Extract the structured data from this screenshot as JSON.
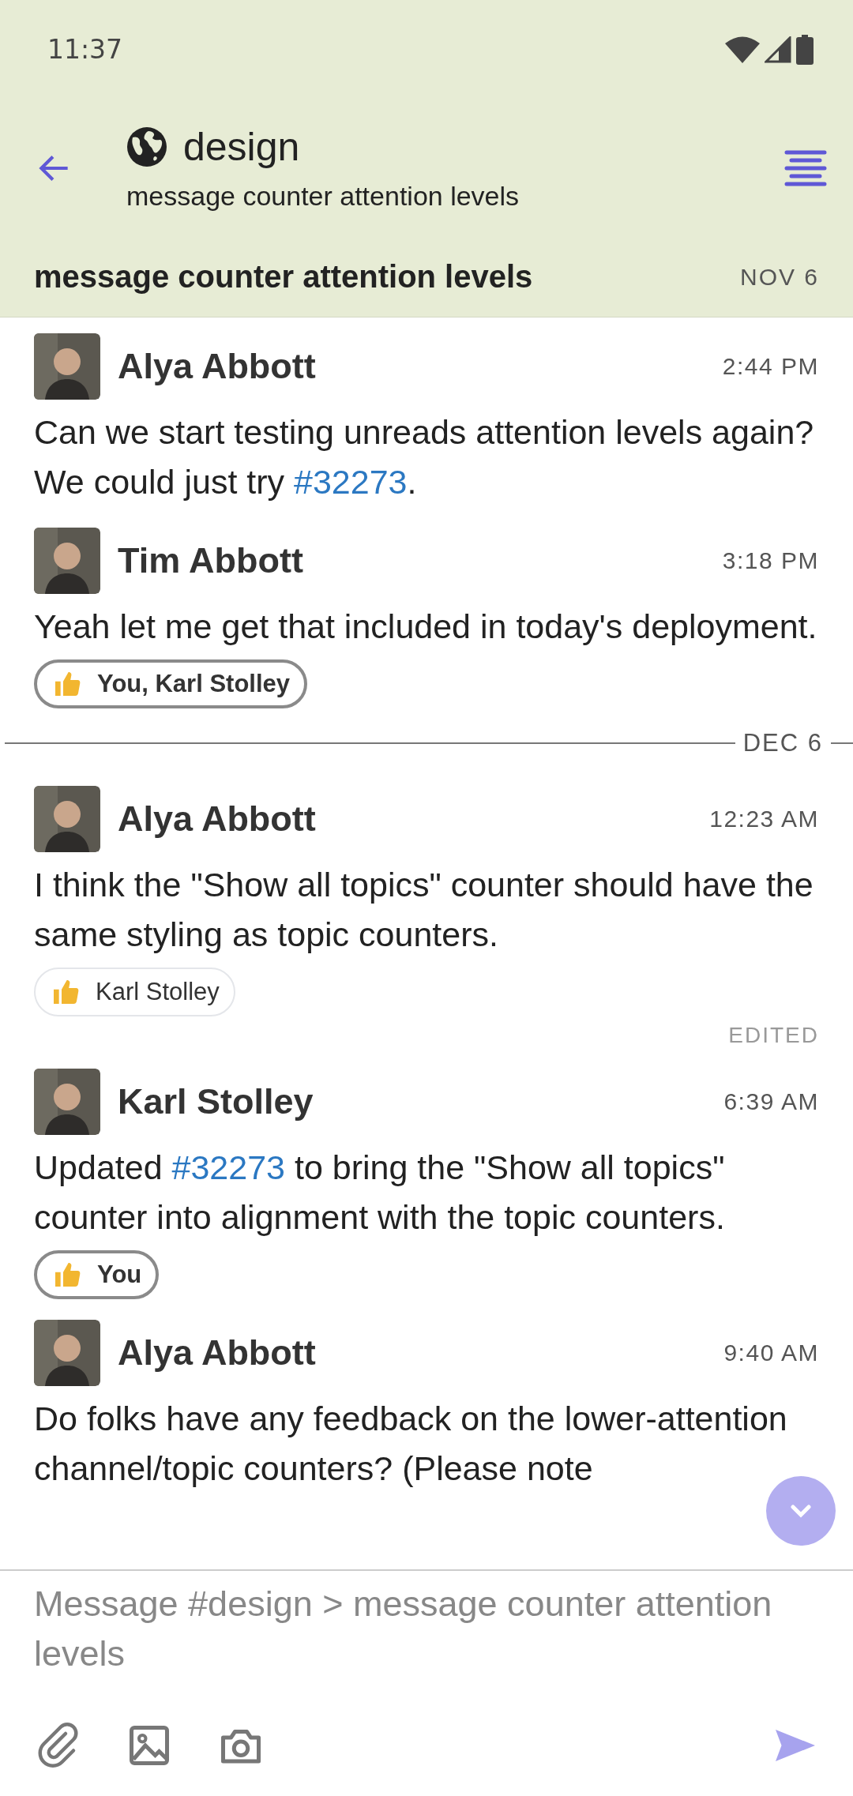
{
  "status_bar": {
    "time": "11:37"
  },
  "app_bar": {
    "channel": "design",
    "topic": "message counter attention levels"
  },
  "topic_header": {
    "topic": "message counter attention levels",
    "date": "NOV 6"
  },
  "messages": [
    {
      "kind": "message",
      "sender": "Alya Abbott",
      "time": "2:44 PM",
      "content": [
        {
          "kind": "text",
          "text": "Can we start testing unreads attention levels again? We could just try "
        },
        {
          "kind": "link",
          "text": "#32273"
        },
        {
          "kind": "text",
          "text": "."
        }
      ]
    },
    {
      "kind": "message",
      "sender": "Tim Abbott",
      "time": "3:18 PM",
      "content": [
        {
          "kind": "text",
          "text": "Yeah let me get that included in today's deployment."
        }
      ],
      "reactions": [
        {
          "label": "You, Karl Stolley",
          "selected": true
        }
      ]
    },
    {
      "kind": "date_divider",
      "label": "DEC 6"
    },
    {
      "kind": "message",
      "sender": "Alya Abbott",
      "time": "12:23 AM",
      "content": [
        {
          "kind": "text",
          "text": "I think the \"Show all topics\" counter should have the same styling as topic counters."
        }
      ],
      "reactions": [
        {
          "label": "Karl Stolley",
          "selected": false
        }
      ],
      "edited_label": "EDITED"
    },
    {
      "kind": "message",
      "sender": "Karl Stolley",
      "time": "6:39 AM",
      "content": [
        {
          "kind": "text",
          "text": "Updated "
        },
        {
          "kind": "link",
          "text": "#32273"
        },
        {
          "kind": "text",
          "text": " to bring the \"Show all topics\" counter into alignment with the topic counters."
        }
      ],
      "reactions": [
        {
          "label": "You",
          "selected": true
        }
      ]
    },
    {
      "kind": "message",
      "sender": "Alya Abbott",
      "time": "9:40 AM",
      "content": [
        {
          "kind": "text",
          "text": "Do folks have any feedback on the lower-attention channel/topic counters? (Please note"
        }
      ]
    }
  ],
  "composer": {
    "placeholder": "Message #design > message counter attention levels"
  }
}
